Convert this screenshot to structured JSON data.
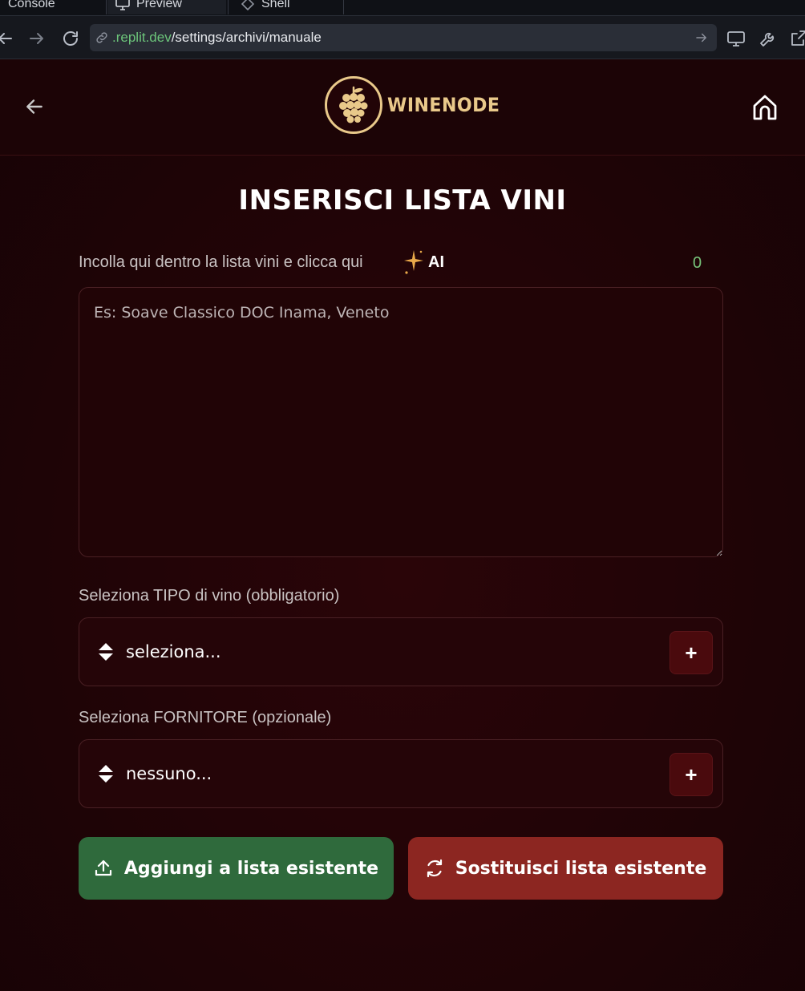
{
  "browser": {
    "tabs": [
      {
        "label": "Console"
      },
      {
        "label": "Preview"
      },
      {
        "label": "Shell"
      }
    ],
    "url_host": ".replit.dev",
    "url_path": "/settings/archivi/manuale"
  },
  "header": {
    "logo_text": "WINENODE"
  },
  "page": {
    "title": "INSERISCI LISTA VINI",
    "paste_label": "Incolla qui dentro la lista vini e clicca qui",
    "ai_label": "AI",
    "counter": "0",
    "textarea_placeholder": "Es: Soave Classico DOC Inama, Veneto",
    "tipo_label": "Seleziona TIPO di vino (obbligatorio)",
    "tipo_value": "seleziona...",
    "fornitore_label": "Seleziona FORNITORE (opzionale)",
    "fornitore_value": "nessuno...",
    "add_symbol": "+",
    "add_button": "Aggiungi a lista esistente",
    "replace_button": "Sostituisci lista esistente"
  },
  "colors": {
    "accent_gold": "#e9c98a",
    "add_green": "#2f6a3c",
    "replace_red": "#8c2621",
    "counter_green": "#78c47a"
  }
}
